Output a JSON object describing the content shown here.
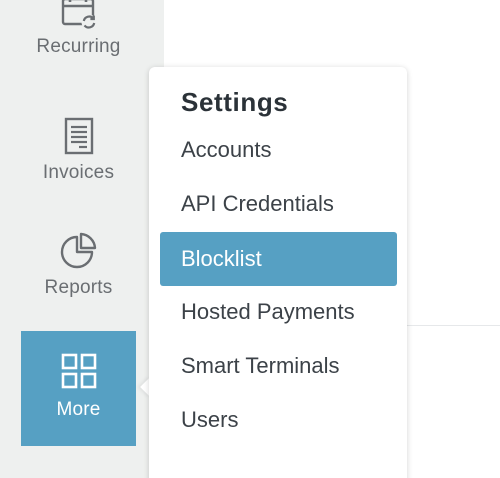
{
  "sidebar": {
    "items": [
      {
        "label": "Recurring",
        "icon": "calendar-refresh-icon",
        "active": false
      },
      {
        "label": "Invoices",
        "icon": "invoice-icon",
        "active": false
      },
      {
        "label": "Reports",
        "icon": "pie-chart-icon",
        "active": false
      },
      {
        "label": "More",
        "icon": "grid-icon",
        "active": true
      }
    ]
  },
  "menu": {
    "title": "Settings",
    "items": [
      {
        "label": "Accounts",
        "active": false
      },
      {
        "label": "API Credentials",
        "active": false
      },
      {
        "label": "Blocklist",
        "active": true
      },
      {
        "label": "Hosted Payments",
        "active": false
      },
      {
        "label": "Smart Terminals",
        "active": false
      },
      {
        "label": "Users",
        "active": false
      }
    ]
  },
  "colors": {
    "accent": "#56a0c3",
    "sidebar_bg": "#eef0ef",
    "nav_text": "#6a6e72",
    "menu_text": "#3c4248",
    "title_text": "#2b3238"
  }
}
